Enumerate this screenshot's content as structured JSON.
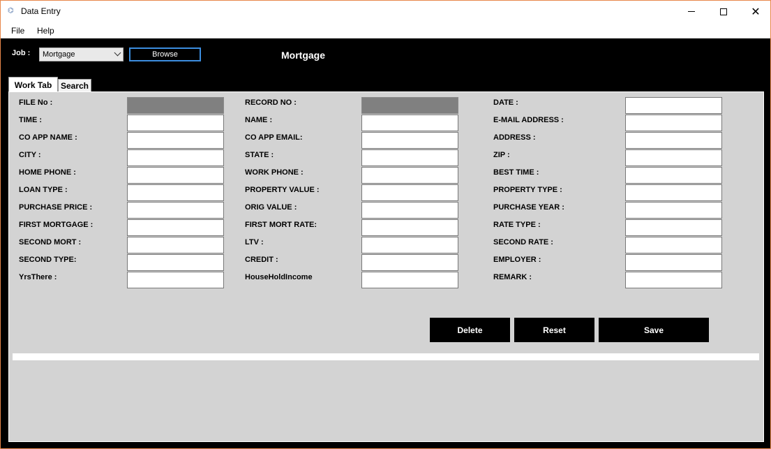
{
  "window": {
    "title": "Data Entry",
    "close_glyph": "✕",
    "app_icon": "⌬"
  },
  "menu": [
    "File",
    "Help"
  ],
  "job": {
    "label": "Job :",
    "selected": "Mortgage",
    "browse_label": "Browse"
  },
  "heading": "Mortgage",
  "tabs": [
    "Work Tab",
    "Search"
  ],
  "fields": {
    "col1": [
      "FILE No :",
      "TIME :",
      "CO APP NAME :",
      "CITY :",
      "HOME PHONE :",
      "LOAN TYPE :",
      "PURCHASE PRICE :",
      "FIRST MORTGAGE :",
      "SECOND MORT :",
      "SECOND TYPE:",
      "YrsThere :"
    ],
    "col2": [
      "RECORD NO :",
      "NAME :",
      "CO APP EMAIL:",
      "STATE :",
      "WORK PHONE :",
      "PROPERTY VALUE :",
      "ORIG VALUE :",
      "FIRST MORT RATE:",
      "LTV :",
      "CREDIT :",
      "HouseHoldIncome"
    ],
    "col3": [
      "DATE :",
      "E-MAIL ADDRESS :",
      "ADDRESS :",
      "ZIP :",
      "BEST TIME :",
      "PROPERTY TYPE :",
      "PURCHASE YEAR :",
      "RATE TYPE :",
      "SECOND RATE :",
      "EMPLOYER :",
      "REMARK :"
    ]
  },
  "actions": {
    "delete": "Delete",
    "reset": "Reset",
    "save": "Save"
  },
  "colors": {
    "accent": "#3c8ee0",
    "panel": "#d3d3d3",
    "readonly": "#808080",
    "border": "#e8874a"
  }
}
